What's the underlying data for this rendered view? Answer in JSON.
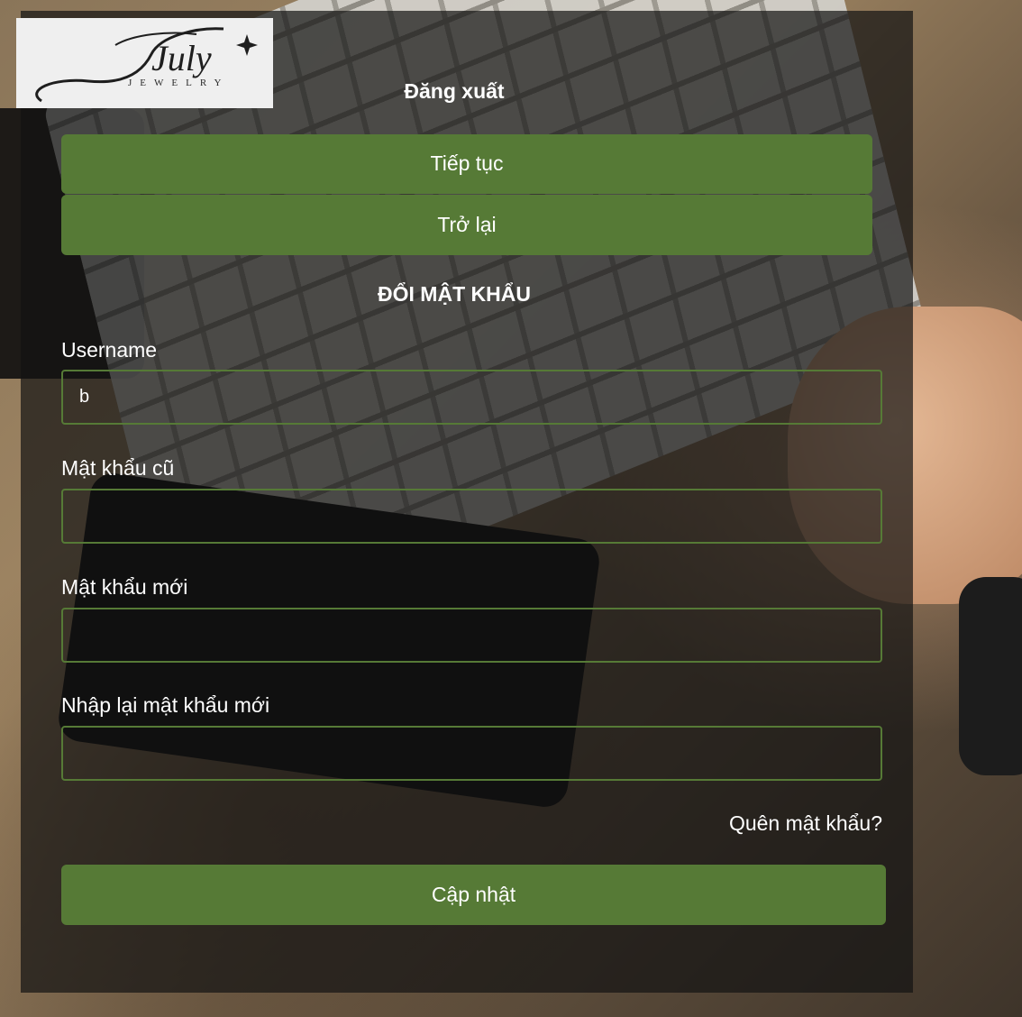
{
  "brand": {
    "logo_script": "July",
    "logo_sub": "JEWELRY"
  },
  "header": {
    "logout_label": "Đăng xuất"
  },
  "actions": {
    "continue_label": "Tiếp tục",
    "back_label": "Trở lại"
  },
  "form": {
    "title": "ĐỔI MẬT KHẨU",
    "username": {
      "label": "Username",
      "value": "b"
    },
    "old_password": {
      "label": "Mật khẩu cũ",
      "value": ""
    },
    "new_password": {
      "label": "Mật khẩu mới",
      "value": ""
    },
    "confirm_password": {
      "label": "Nhập lại mật khẩu mới",
      "value": ""
    },
    "forgot_label": "Quên mật khẩu?",
    "submit_label": "Cập nhật"
  },
  "colors": {
    "accent": "#567a36",
    "panel": "rgba(18,18,18,0.70)",
    "text": "#ffffff"
  }
}
